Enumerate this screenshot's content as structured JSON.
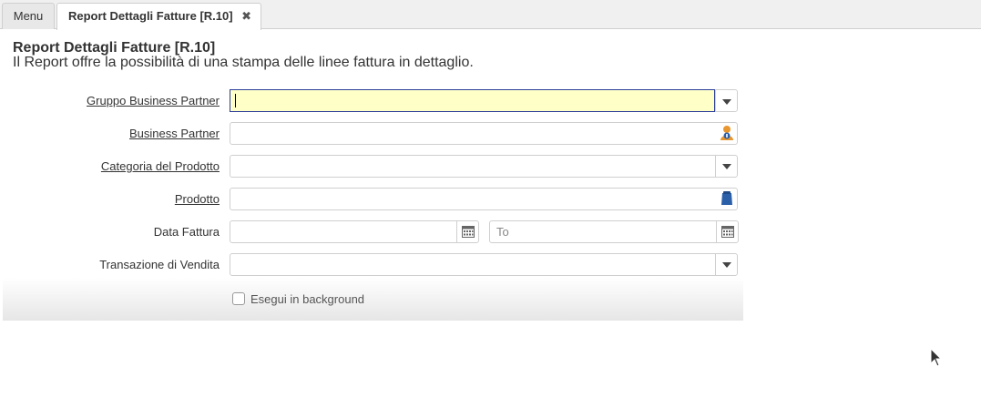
{
  "tabs": {
    "menu_label": "Menu",
    "report_label": "Report Dettagli Fatture [R.10]",
    "close_glyph": "✖"
  },
  "header": {
    "title": "Report Dettagli Fatture [R.10]",
    "description": "Il Report offre la possibilità di una stampa delle linee fattura in dettaglio."
  },
  "form": {
    "gruppo_bp_label": "Gruppo Business Partner",
    "gruppo_bp_value": "",
    "bp_label": "Business Partner",
    "bp_value": "",
    "categoria_label": "Categoria del Prodotto",
    "categoria_value": "",
    "prodotto_label": "Prodotto",
    "prodotto_value": "",
    "data_fattura_label": "Data Fattura",
    "data_from_value": "",
    "data_to_placeholder": "To",
    "transazione_label": "Transazione di Vendita",
    "transazione_value": "",
    "background_label": "Esegui in background",
    "background_checked": false
  },
  "icons": {
    "dropdown": "chevron-down-icon",
    "bp_search": "person-search-icon",
    "product_search": "product-search-icon",
    "calendar": "calendar-icon"
  },
  "colors": {
    "active_field_bg": "#ffffc8",
    "active_field_border": "#2b3e9a",
    "search_icon_blue": "#2b5fa8",
    "search_icon_orange": "#e8962e"
  }
}
